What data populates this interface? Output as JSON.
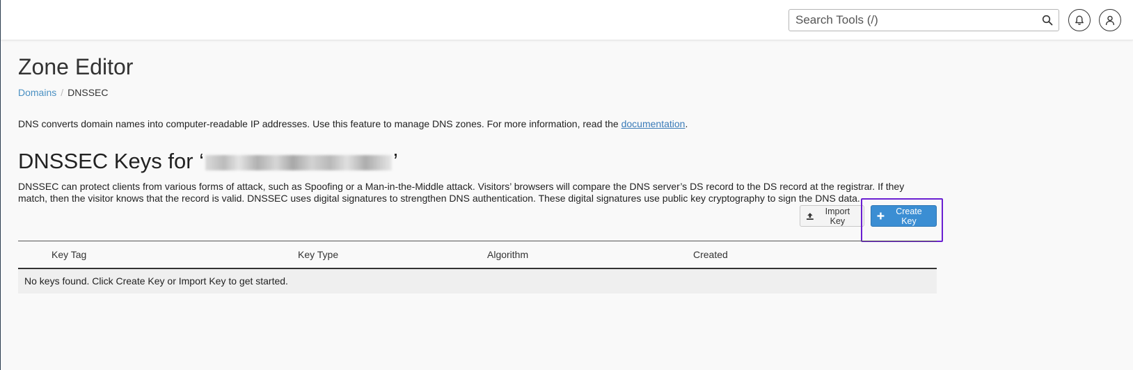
{
  "header": {
    "search_placeholder": "Search Tools (/)",
    "icons": [
      "search-icon",
      "bell-icon",
      "user-icon"
    ]
  },
  "page": {
    "title": "Zone Editor",
    "breadcrumb": {
      "items": [
        "Domains",
        "DNSSEC"
      ],
      "separator": "/"
    },
    "intro_text": "DNS converts domain names into computer-readable IP addresses. Use this feature to manage DNS zones. For more information, read the ",
    "intro_link": "documentation",
    "intro_end": "."
  },
  "section": {
    "title_prefix": "DNSSEC Keys for ‘",
    "title_suffix": "’",
    "description": "DNSSEC can protect clients from various forms of attack, such as Spoofing or a Man-in-the-Middle attack. Visitors’ browsers will compare the DNS server’s DS record to the DS record at the registrar. If they match, then the visitor knows that the record is valid. DNSSEC uses digital signatures to strengthen DNS authentication. These digital signatures use public key cryptography to sign the DNS data."
  },
  "actions": {
    "import_label": "Import Key",
    "create_label": "Create Key"
  },
  "table": {
    "columns": [
      "Key Tag",
      "Key Type",
      "Algorithm",
      "Created"
    ],
    "empty_message": "No keys found. Click Create Key or Import Key to get started."
  },
  "colors": {
    "primary": "#3b8ed3",
    "link": "#4a90c2",
    "focus_ring": "#6a1fd1"
  }
}
